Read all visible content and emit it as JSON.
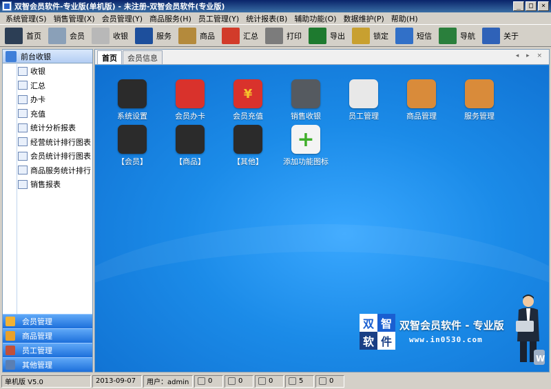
{
  "window": {
    "title": "双智会员软件-专业版(单机版) - 未注册-双智会员软件(专业版)",
    "controls": [
      "_",
      "□",
      "×"
    ]
  },
  "menu": [
    "系统管理(S)",
    "销售管理(X)",
    "会员管理(Y)",
    "商品服务(H)",
    "员工管理(Y)",
    "统计报表(B)",
    "辅助功能(O)",
    "数据维护(P)",
    "帮助(H)"
  ],
  "toolbar": [
    {
      "label": "首页",
      "icon": "monitor-icon",
      "color": "#2c3e55"
    },
    {
      "label": "会员",
      "icon": "card-icon",
      "color": "#8aa0b8"
    },
    {
      "label": "收银",
      "icon": "calculator-icon",
      "color": "#b8b8b8"
    },
    {
      "label": "服务",
      "icon": "books-icon",
      "color": "#1d4f9c"
    },
    {
      "label": "商品",
      "icon": "box-icon",
      "color": "#b48a3c"
    },
    {
      "label": "汇总",
      "icon": "bar-chart-icon",
      "color": "#d23b2a"
    },
    {
      "label": "打印",
      "icon": "printer-icon",
      "color": "#7c7c7c"
    },
    {
      "label": "导出",
      "icon": "excel-icon",
      "color": "#1e7a2f"
    },
    {
      "label": "锁定",
      "icon": "lock-icon",
      "color": "#c8a030"
    },
    {
      "label": "短信",
      "icon": "screen-icon",
      "color": "#3170c8"
    },
    {
      "label": "导航",
      "icon": "sitemap-icon",
      "color": "#2a7f3c"
    },
    {
      "label": "关于",
      "icon": "about-icon",
      "color": "#2f62b8"
    }
  ],
  "left_panel": {
    "header": "前台收银",
    "items": [
      {
        "label": "收银",
        "icon": "cash-icon"
      },
      {
        "label": "汇总",
        "icon": "summary-icon"
      },
      {
        "label": "办卡",
        "icon": "card-icon"
      },
      {
        "label": "充值",
        "icon": "recharge-icon"
      },
      {
        "label": "统计分析报表",
        "icon": "report-icon"
      },
      {
        "label": "经营统计排行图表",
        "icon": "chart-icon"
      },
      {
        "label": "会员统计排行图表",
        "icon": "chart-icon"
      },
      {
        "label": "商品服务统计排行",
        "icon": "chart-icon"
      },
      {
        "label": "销售报表",
        "icon": "table-icon"
      }
    ],
    "groups": [
      {
        "label": "会员管理",
        "icon": "members-icon",
        "color": "#f2b233"
      },
      {
        "label": "商品管理",
        "icon": "goods-icon",
        "color": "#e9a12b"
      },
      {
        "label": "员工管理",
        "icon": "staff-icon",
        "color": "#c0503a"
      },
      {
        "label": "其他管理",
        "icon": "other-icon",
        "color": "#5a7fb3"
      }
    ]
  },
  "tabs": [
    {
      "label": "首页",
      "active": true
    },
    {
      "label": "会员信息",
      "active": false
    }
  ],
  "desktop_apps": [
    {
      "label": "系统设置",
      "icon": "tv-icon",
      "color": "#2b2b2b"
    },
    {
      "label": "会员办卡",
      "icon": "member-card-icon",
      "color": "#d9322c"
    },
    {
      "label": "会员充值",
      "icon": "yen-calendar-icon",
      "color": "#d9322c"
    },
    {
      "label": "销售收银",
      "icon": "cash-register-icon",
      "color": "#555a60"
    },
    {
      "label": "员工管理",
      "icon": "staff-icon",
      "color": "#e8e8e8"
    },
    {
      "label": "商品管理",
      "icon": "goods-box-icon",
      "color": "#d98b3a"
    },
    {
      "label": "服务管理",
      "icon": "service-icon",
      "color": "#d98b3a"
    },
    {
      "label": "【会员】",
      "icon": "folder-screen-icon",
      "color": "#2b2b2b"
    },
    {
      "label": "【商品】",
      "icon": "folder-screen-icon",
      "color": "#2b2b2b"
    },
    {
      "label": "【其他】",
      "icon": "folder-screen-icon",
      "color": "#2b2b2b"
    },
    {
      "label": "添加功能图标",
      "icon": "add-icon",
      "color": "#f4f4f4"
    }
  ],
  "brand": {
    "logo_chars": [
      "双",
      "智",
      "软",
      "件"
    ],
    "name": "双智会员软件 - 专业版",
    "url": "www.in0530.com"
  },
  "status": {
    "edition": "单机版 V5.0",
    "date": "2013-09-07",
    "user": "用户：admin",
    "counters": [
      {
        "icon": "star-icon",
        "value": "0"
      },
      {
        "icon": "doc-icon",
        "value": "0"
      },
      {
        "icon": "message-icon",
        "value": "0"
      },
      {
        "icon": "user-icon",
        "value": "5"
      },
      {
        "icon": "gift-icon",
        "value": "0"
      }
    ]
  }
}
